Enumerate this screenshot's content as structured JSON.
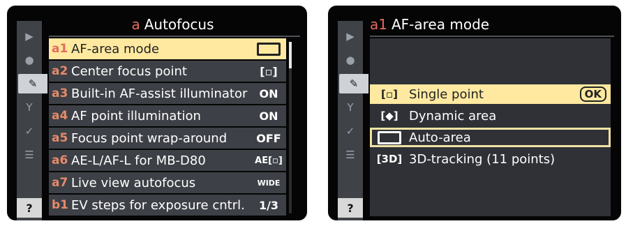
{
  "left_screen": {
    "title_prefix": "a",
    "title": "Autofocus",
    "rows": [
      {
        "code": "a1",
        "label": "AF-area mode",
        "value": "[▬]",
        "selected": true
      },
      {
        "code": "a2",
        "label": "Center focus point",
        "value": "[▫]",
        "selected": false
      },
      {
        "code": "a3",
        "label": "Built-in AF-assist illuminator",
        "value": "ON",
        "selected": false
      },
      {
        "code": "a4",
        "label": "AF point illumination",
        "value": "ON",
        "selected": false
      },
      {
        "code": "a5",
        "label": "Focus point wrap-around",
        "value": "OFF",
        "selected": false
      },
      {
        "code": "a6",
        "label": "AE-L/AF-L for MB-D80",
        "value": "AE[▫]",
        "selected": false
      },
      {
        "code": "a7",
        "label": "Live view autofocus",
        "value": "WIDE",
        "selected": false
      },
      {
        "code": "b1",
        "label": "EV steps for exposure cntrl.",
        "value": "1/3",
        "selected": false
      }
    ],
    "sidebar_icons": [
      "play-icon",
      "camera-icon",
      "pencil-icon",
      "wrench-icon",
      "retouch-icon",
      "my-menu-icon",
      "help-icon"
    ]
  },
  "right_screen": {
    "title_prefix": "a1",
    "title": "AF-area mode",
    "options": [
      {
        "icon": "[▫]",
        "label": "Single point",
        "badge": "OK",
        "selected": true,
        "boxed": false
      },
      {
        "icon": "[◆]",
        "label": "Dynamic area",
        "badge": "",
        "selected": false,
        "boxed": false
      },
      {
        "icon": "[▬]",
        "label": "Auto-area",
        "badge": "",
        "selected": false,
        "boxed": true
      },
      {
        "icon": "[3D]",
        "label": "3D-tracking (11 points)",
        "badge": "",
        "selected": false,
        "boxed": false
      }
    ],
    "sidebar_icons": [
      "play-icon",
      "camera-icon",
      "pencil-icon",
      "wrench-icon",
      "retouch-icon",
      "my-menu-icon",
      "help-icon"
    ]
  },
  "help_label": "?"
}
